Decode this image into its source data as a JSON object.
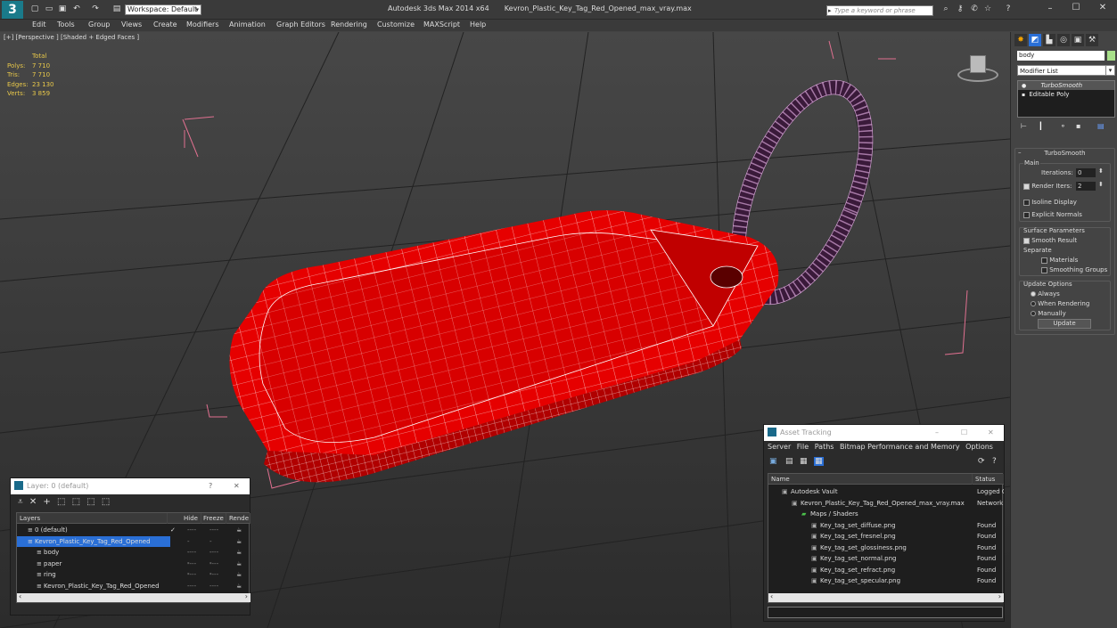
{
  "titlebar": {
    "workspace": "Workspace: Default",
    "app_title": "Autodesk 3ds Max  2014 x64",
    "file_title": "Kevron_Plastic_Key_Tag_Red_Opened_max_vray.max",
    "search_placeholder": "Type a keyword or phrase",
    "min": "–",
    "max": "☐",
    "close": "✕"
  },
  "menu": [
    "Edit",
    "Tools",
    "Group",
    "Views",
    "Create",
    "Modifiers",
    "Animation",
    "Graph Editors",
    "Rendering",
    "Customize",
    "MAXScript",
    "Help"
  ],
  "viewport": {
    "label": "[+] [Perspective ] [Shaded + Edged Faces ]",
    "stats_header": "Total",
    "stats": [
      {
        "k": "Polys:",
        "v": "7 710"
      },
      {
        "k": "Tris:",
        "v": "7 710"
      },
      {
        "k": "Edges:",
        "v": "23 130"
      },
      {
        "k": "Verts:",
        "v": "3 859"
      }
    ]
  },
  "cmdpanel": {
    "object_name": "body",
    "modifier_list": "Modifier List",
    "stack": [
      "TurboSmooth",
      "Editable Poly"
    ],
    "rollout_title": "TurboSmooth",
    "main": "Main",
    "iterations_label": "Iterations:",
    "iterations_value": "0",
    "render_iters_label": "Render Iters:",
    "render_iters_value": "2",
    "isoline": "Isoline Display",
    "explicit_normals": "Explicit Normals",
    "surface_params": "Surface Parameters",
    "smooth_result": "Smooth Result",
    "separate": "Separate",
    "materials": "Materials",
    "smoothing_groups": "Smoothing Groups",
    "update_options": "Update Options",
    "always": "Always",
    "when_rendering": "When Rendering",
    "manually": "Manually",
    "update_btn": "Update"
  },
  "layers": {
    "title": "Layer: 0 (default)",
    "help": "?",
    "close": "✕",
    "cols": [
      "Layers",
      "Hide",
      "Freeze",
      "Rende"
    ],
    "rows": [
      {
        "name": "0 (default)",
        "indent": 0,
        "sel": false,
        "hide": "----",
        "freeze": "----"
      },
      {
        "name": "Kevron_Plastic_Key_Tag_Red_Opened",
        "indent": 0,
        "sel": true,
        "hide": "----",
        "freeze": "----"
      },
      {
        "name": "body",
        "indent": 1,
        "sel": false,
        "hide": "----",
        "freeze": "----"
      },
      {
        "name": "paper",
        "indent": 1,
        "sel": false,
        "hide": "----",
        "freeze": "----"
      },
      {
        "name": "ring",
        "indent": 1,
        "sel": false,
        "hide": "----",
        "freeze": "----"
      },
      {
        "name": "Kevron_Plastic_Key_Tag_Red_Opened",
        "indent": 1,
        "sel": false,
        "hide": "----",
        "freeze": "----"
      }
    ]
  },
  "assets": {
    "title": "Asset Tracking",
    "min": "–",
    "max": "☐",
    "close": "✕",
    "menu": [
      "Server",
      "File",
      "Paths",
      "Bitmap Performance and Memory",
      "Options"
    ],
    "cols": [
      "Name",
      "Status"
    ],
    "rows": [
      {
        "name": "Autodesk Vault",
        "status": "Logged O",
        "indent": 1
      },
      {
        "name": "Kevron_Plastic_Key_Tag_Red_Opened_max_vray.max",
        "status": "Network",
        "indent": 2
      },
      {
        "name": "Maps / Shaders",
        "status": "",
        "indent": 3
      },
      {
        "name": "Key_tag_set_diffuse.png",
        "status": "Found",
        "indent": 4
      },
      {
        "name": "Key_tag_set_fresnel.png",
        "status": "Found",
        "indent": 4
      },
      {
        "name": "Key_tag_set_glossiness.png",
        "status": "Found",
        "indent": 4
      },
      {
        "name": "Key_tag_set_normal.png",
        "status": "Found",
        "indent": 4
      },
      {
        "name": "Key_tag_set_refract.png",
        "status": "Found",
        "indent": 4
      },
      {
        "name": "Key_tag_set_specular.png",
        "status": "Found",
        "indent": 4
      }
    ]
  },
  "colors": {
    "accent": "#2a6fd6",
    "stats": "#e8c84a",
    "model": "#ff0000",
    "wire": "#ffffff"
  }
}
